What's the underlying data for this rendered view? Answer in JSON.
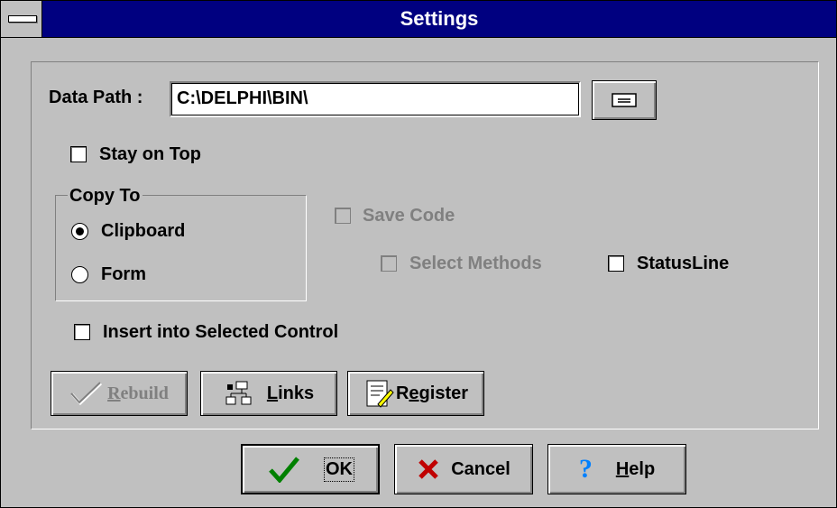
{
  "window": {
    "title": "Settings"
  },
  "data_path": {
    "label": "Data Path :",
    "value": "C:\\DELPHI\\BIN\\"
  },
  "stay_on_top": {
    "label": "Stay on Top",
    "checked": false
  },
  "copy_to": {
    "legend": "Copy To",
    "options": [
      {
        "label": "Clipboard",
        "selected": true
      },
      {
        "label": "Form",
        "selected": false
      }
    ]
  },
  "save_code": {
    "label": "Save Code",
    "enabled": false,
    "checked": false
  },
  "select_methods": {
    "label": "Select Methods",
    "enabled": false,
    "checked": false
  },
  "status_line": {
    "label": "StatusLine",
    "checked": false
  },
  "insert_selected": {
    "label": "Insert into Selected Control",
    "checked": false
  },
  "tool_buttons": {
    "rebuild": {
      "prefix": "",
      "hot": "R",
      "rest": "ebuild",
      "enabled": false
    },
    "links": {
      "prefix": "",
      "hot": "L",
      "rest": "inks"
    },
    "register": {
      "prefix": "R",
      "hot": "e",
      "rest": "gister"
    }
  },
  "dialog_buttons": {
    "ok": {
      "label": "OK"
    },
    "cancel": {
      "label": "Cancel"
    },
    "help": {
      "hot": "H",
      "rest": "elp"
    }
  }
}
